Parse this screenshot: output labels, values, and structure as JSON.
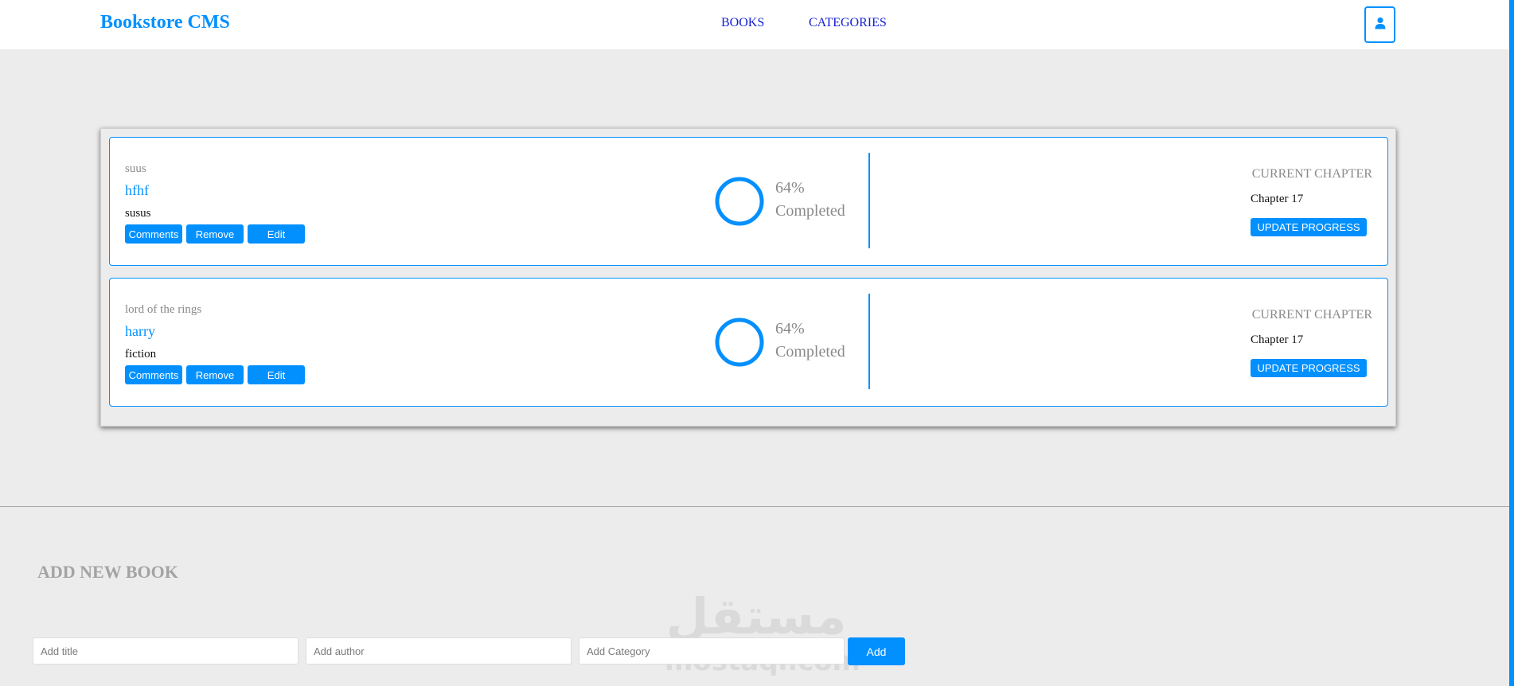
{
  "header": {
    "logo": "Bookstore CMS",
    "nav": [
      {
        "label": "BOOKS"
      },
      {
        "label": "CATEGORIES"
      }
    ],
    "user_icon": "user-icon"
  },
  "books": [
    {
      "genre": "suus",
      "title": "hfhf",
      "author": "susus",
      "actions": {
        "comments": "Comments",
        "remove": "Remove",
        "edit": "Edit"
      },
      "progress_percent": "64%",
      "progress_label": "Completed",
      "chapter_heading": "CURRENT CHAPTER",
      "chapter": "Chapter 17",
      "update_label": "UPDATE PROGRESS"
    },
    {
      "genre": "lord of the rings",
      "title": "harry",
      "author": "fiction",
      "actions": {
        "comments": "Comments",
        "remove": "Remove",
        "edit": "Edit"
      },
      "progress_percent": "64%",
      "progress_label": "Completed",
      "chapter_heading": "CURRENT CHAPTER",
      "chapter": "Chapter 17",
      "update_label": "UPDATE PROGRESS"
    }
  ],
  "add_form": {
    "heading": "ADD NEW BOOK",
    "title_placeholder": "Add title",
    "author_placeholder": "Add author",
    "category_placeholder": "Add Category",
    "add_label": "Add"
  },
  "watermark": {
    "arabic": "مستقل",
    "latin": "mostaql.com"
  },
  "colors": {
    "accent": "#0290ff",
    "nav_link": "#121ed4",
    "background": "#ececec"
  }
}
